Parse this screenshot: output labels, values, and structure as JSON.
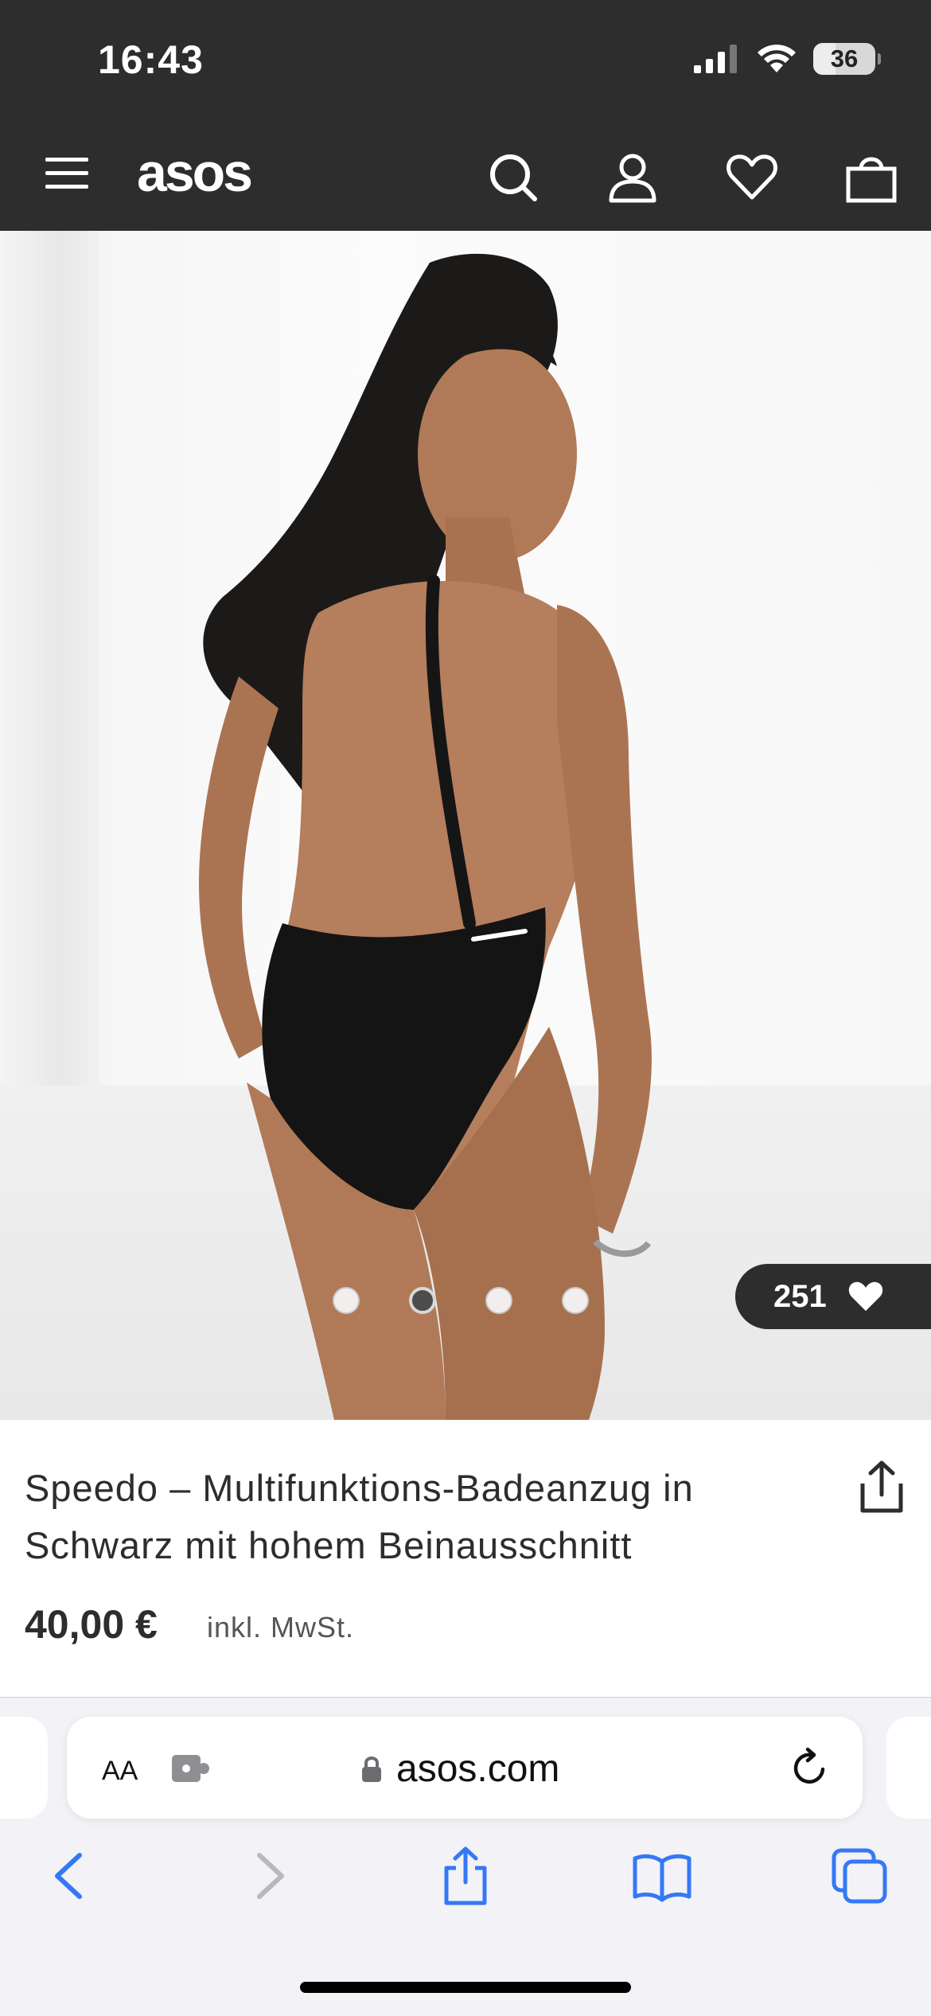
{
  "status_bar": {
    "time": "16:43",
    "battery": "36",
    "battery_level": 0.36
  },
  "header": {
    "logo": "asos"
  },
  "gallery": {
    "image_count": 4,
    "active_index": 1,
    "likes": "251"
  },
  "product": {
    "title": "Speedo – Multifunktions-Badeanzug in Schwarz mit hohem Beinausschnitt",
    "price": "40,00 €",
    "vat": "inkl. MwSt."
  },
  "browser": {
    "text_size": "AA",
    "url": "asos.com"
  },
  "colors": {
    "dark": "#2d2d2d",
    "ios_blue": "#3478f6"
  }
}
